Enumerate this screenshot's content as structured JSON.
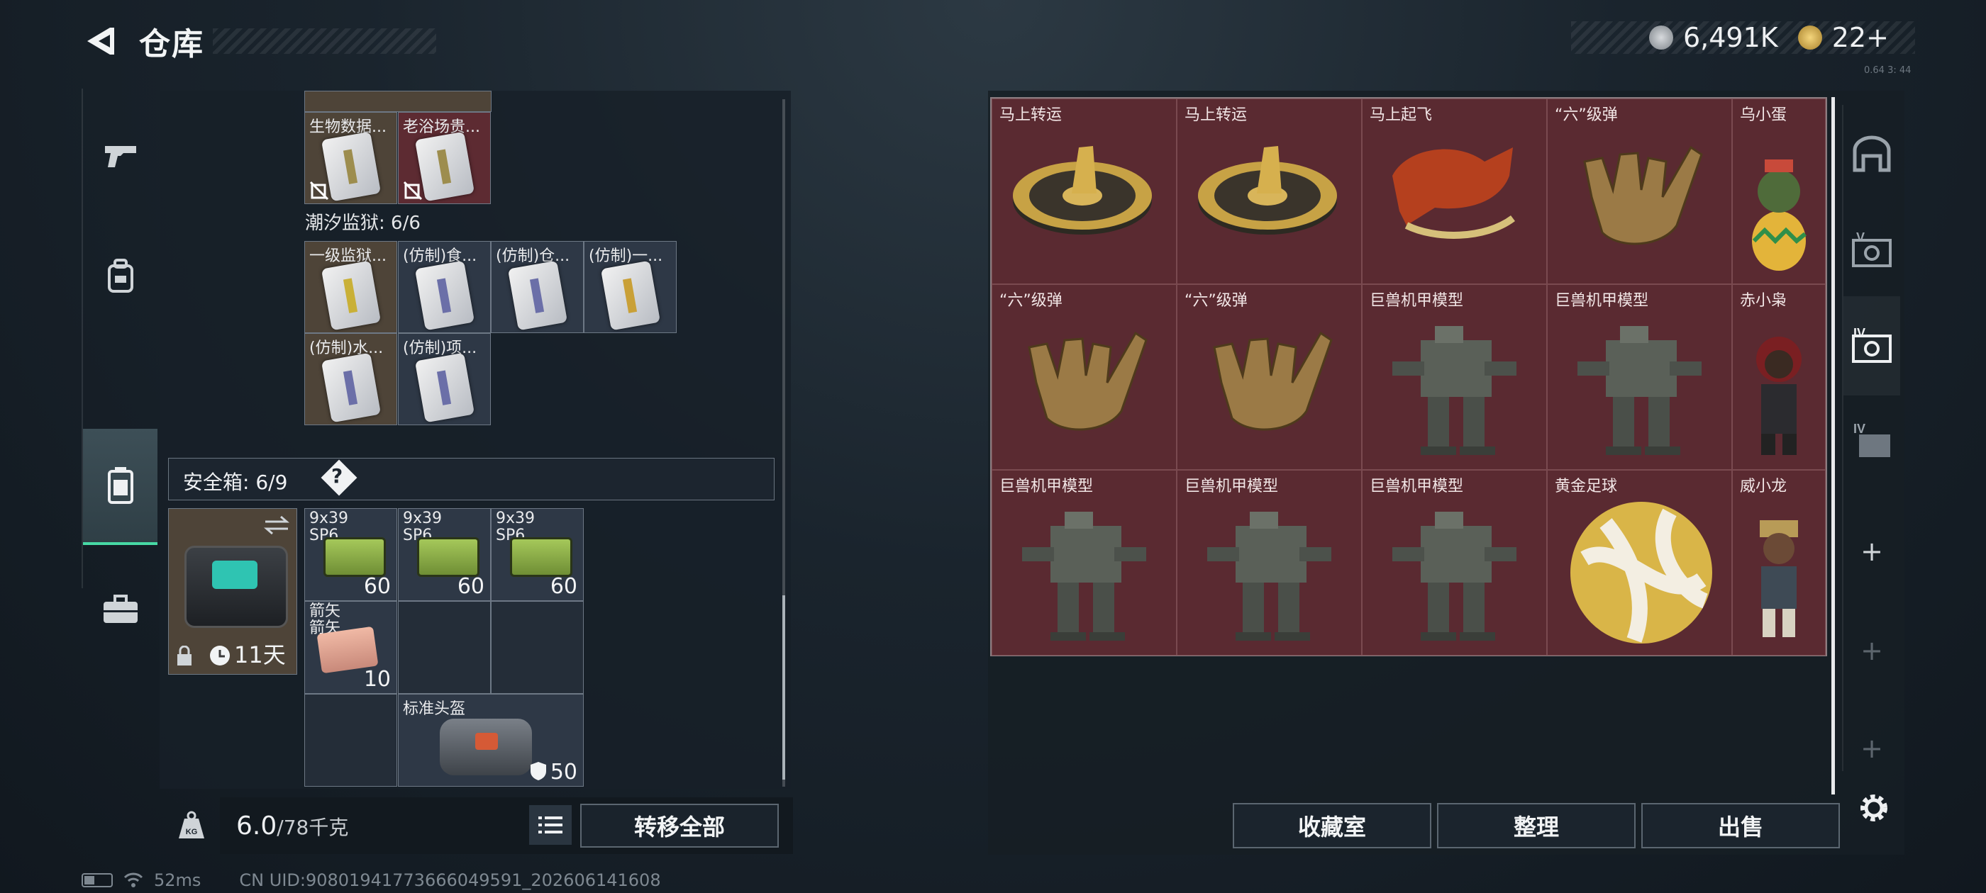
{
  "header": {
    "title": "仓库"
  },
  "currency": {
    "silver": "6,491K",
    "gold": "22+"
  },
  "version": "0.64 3: 44",
  "left_tabs": [
    "firearms-tab",
    "backpack-tab",
    "container-tab",
    "case-tab"
  ],
  "stash": {
    "top_items": [
      {
        "label": "生物数据...",
        "color": "brown"
      },
      {
        "label": "老浴场贵...",
        "color": "red"
      }
    ],
    "section_tide_prison": "潮汐监狱: 6/6",
    "prison_items": [
      {
        "label": "一级监狱..."
      },
      {
        "label": "(仿制)食..."
      },
      {
        "label": "(仿制)仓..."
      },
      {
        "label": "(仿制)一..."
      },
      {
        "label": "(仿制)水..."
      },
      {
        "label": "(仿制)项..."
      }
    ],
    "safe_box_label": "安全箱: 6/9",
    "safe_box_help": "?",
    "safe_box_days": "11天",
    "ammo_items": [
      {
        "label": "9x39\nSP6",
        "count": "60"
      },
      {
        "label": "9x39\nSP6",
        "count": "60"
      },
      {
        "label": "9x39\nSP6",
        "count": "60"
      }
    ],
    "arrow_item": {
      "label": "箭矢\n箭矢",
      "count": "10"
    },
    "helmet_item": {
      "label": "标准头盔",
      "count": "50"
    }
  },
  "weight": {
    "current": "6.0",
    "max": "/78千克"
  },
  "transfer_all_label": "转移全部",
  "collection": [
    {
      "label": "马上转运",
      "art": "coin"
    },
    {
      "label": "马上转运",
      "art": "coin"
    },
    {
      "label": "马上起飞",
      "art": "horse"
    },
    {
      "label": "“六”级弹",
      "art": "hand"
    },
    {
      "label": "乌小蛋",
      "art": "egg"
    },
    {
      "label": "“六”级弹",
      "art": "hand"
    },
    {
      "label": "“六”级弹",
      "art": "hand"
    },
    {
      "label": "巨兽机甲模型",
      "art": "mech"
    },
    {
      "label": "巨兽机甲模型",
      "art": "mech"
    },
    {
      "label": "赤小枭",
      "art": "figure"
    },
    {
      "label": "巨兽机甲模型",
      "art": "mech"
    },
    {
      "label": "巨兽机甲模型",
      "art": "mech"
    },
    {
      "label": "巨兽机甲模型",
      "art": "mech"
    },
    {
      "label": "黄金足球",
      "art": "ball"
    },
    {
      "label": "威小龙",
      "art": "figure2"
    }
  ],
  "right_tabs": [
    "+",
    "+",
    "+"
  ],
  "buttons": {
    "collection_room": "收藏室",
    "sort": "整理",
    "sell": "出售"
  },
  "status": {
    "ping": "52ms",
    "uid": "CN UID:908019417736660495​91_202606141608"
  },
  "colors": {
    "accent": "#47d9a5",
    "item_red": "#5a2a31",
    "item_brown": "#4e4438"
  }
}
